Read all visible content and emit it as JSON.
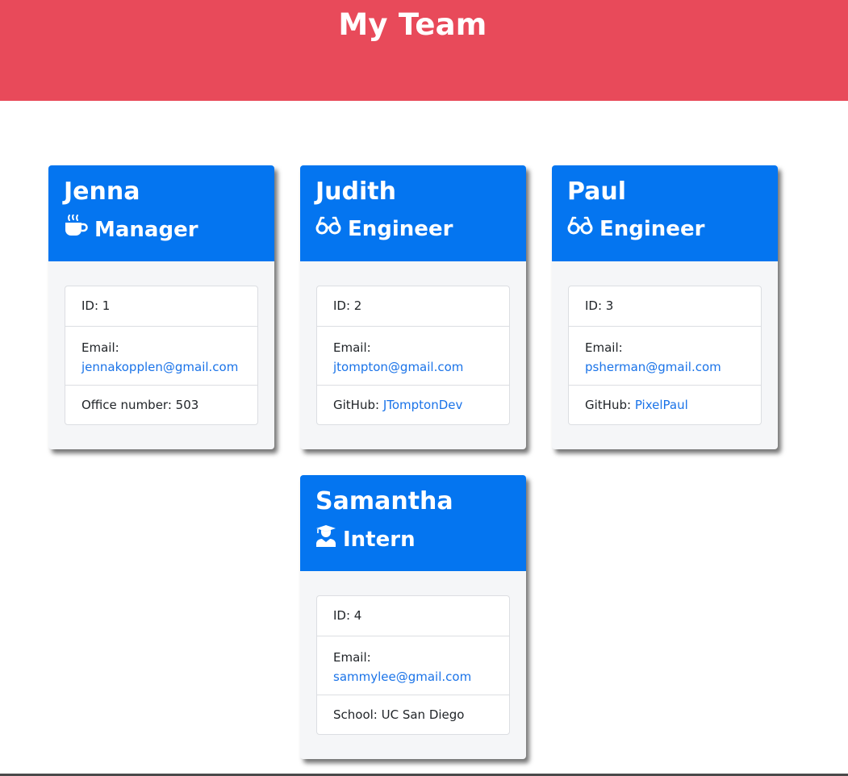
{
  "page": {
    "title": "My Team"
  },
  "colors": {
    "banner": "#e84a5a",
    "card_header": "#0475f0",
    "link": "#1a73e8"
  },
  "cards": [
    {
      "name": "Jenna",
      "role": "Manager",
      "icon": "coffee-icon",
      "id_text": "ID: 1",
      "email_label": "Email:",
      "email": "jennakopplen@gmail.com",
      "extra_label": "Office number: 503",
      "extra_link": ""
    },
    {
      "name": "Judith",
      "role": "Engineer",
      "icon": "glasses-icon",
      "id_text": "ID: 2",
      "email_label": "Email:",
      "email": "jtompton@gmail.com",
      "extra_label": "GitHub: ",
      "extra_link": "JTomptonDev"
    },
    {
      "name": "Paul",
      "role": "Engineer",
      "icon": "glasses-icon",
      "id_text": "ID: 3",
      "email_label": "Email:",
      "email": "psherman@gmail.com",
      "extra_label": "GitHub: ",
      "extra_link": "PixelPaul"
    },
    {
      "name": "Samantha",
      "role": "Intern",
      "icon": "graduate-icon",
      "id_text": "ID: 4",
      "email_label": "Email:",
      "email": "sammylee@gmail.com",
      "extra_label": "School: UC San Diego",
      "extra_link": ""
    }
  ]
}
